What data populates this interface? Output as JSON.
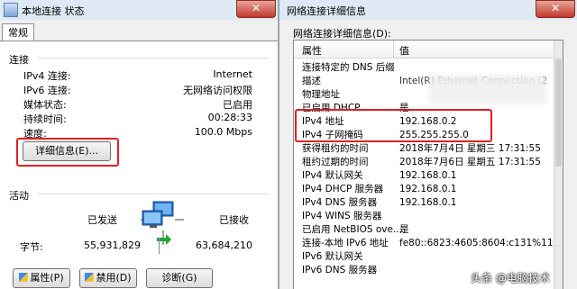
{
  "left_window": {
    "title": "本地连接 状态",
    "close_glyph": "✕",
    "tab": "常规",
    "connection": {
      "heading": "连接",
      "rows": [
        {
          "label": "IPv4 连接:",
          "value": "Internet"
        },
        {
          "label": "IPv6 连接:",
          "value": "无网络访问权限"
        },
        {
          "label": "媒体状态:",
          "value": "已启用"
        },
        {
          "label": "持续时间:",
          "value": "00:28:33"
        },
        {
          "label": "速度:",
          "value": "100.0 Mbps"
        }
      ],
      "details_button": "详细信息(E)..."
    },
    "activity": {
      "heading": "活动",
      "sent_label": "已发送",
      "received_label": "已接收",
      "bytes_label": "字节:",
      "bytes_sent": "55,931,829",
      "bytes_received": "63,684,210"
    },
    "buttons": {
      "properties": "属性(P)",
      "disable": "禁用(D)",
      "diagnose": "诊断(G)"
    }
  },
  "right_window": {
    "title": "网络连接详细信息",
    "close_glyph": "✕",
    "group_label": "网络连接详细信息(D):",
    "columns": {
      "property": "属性",
      "value": "值"
    },
    "rows": [
      {
        "p": "连接特定的 DNS 后缀",
        "v": ""
      },
      {
        "p": "描述",
        "v": "Intel(R) Ethernet Connection (2"
      },
      {
        "p": "物理地址",
        "v": ""
      },
      {
        "p": "已启用 DHCP",
        "v": "是"
      },
      {
        "p": "IPv4 地址",
        "v": "192.168.0.2"
      },
      {
        "p": "IPv4 子网掩码",
        "v": "255.255.255.0"
      },
      {
        "p": "获得租约的时间",
        "v": "2018年7月4日 星期三 17:31:55"
      },
      {
        "p": "租约过期的时间",
        "v": "2018年7月6日 星期五 17:31:55"
      },
      {
        "p": "IPv4 默认网关",
        "v": "192.168.0.1"
      },
      {
        "p": "IPv4 DHCP 服务器",
        "v": "192.168.0.1"
      },
      {
        "p": "IPv4 DNS 服务器",
        "v": "192.168.0.1"
      },
      {
        "p": "IPv4 WINS 服务器",
        "v": ""
      },
      {
        "p": "已启用 NetBIOS ove...",
        "v": "是"
      },
      {
        "p": "连接-本地 IPv6 地址",
        "v": "fe80::6823:4605:8604:c131%11"
      },
      {
        "p": "IPv6 默认网关",
        "v": ""
      },
      {
        "p": "IPv6 DNS 服务器",
        "v": ""
      }
    ]
  },
  "watermark": "头条 @电脑技术",
  "colors": {
    "highlight": "#e02020",
    "titlebar": "#dfe9f5",
    "window_bg": "#f0f0f0"
  }
}
